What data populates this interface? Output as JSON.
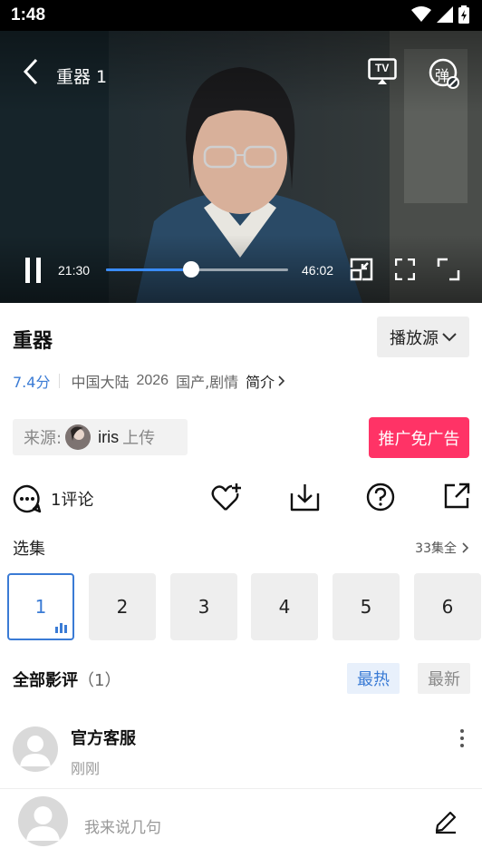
{
  "status": {
    "time": "1:48"
  },
  "player": {
    "title": "重器 1",
    "current_time": "21:30",
    "total_time": "46:02",
    "progress_fraction": 0.467,
    "tv_label": "TV",
    "danmaku_label": "弹"
  },
  "info": {
    "title": "重器",
    "source_button": "播放源",
    "score": "7.4分",
    "region": "中国大陆",
    "year": "2026",
    "genres": "国产,剧情",
    "intro_link": "简介"
  },
  "uploader": {
    "prefix": "来源:",
    "name": "iris",
    "suffix": "上传"
  },
  "promo_button": "推广免广告",
  "actions": {
    "comment_count": "1评论"
  },
  "episodes": {
    "label": "选集",
    "total": "33集全",
    "items": [
      "1",
      "2",
      "3",
      "4",
      "5",
      "6"
    ],
    "active_index": 0
  },
  "reviews": {
    "title": "全部影评",
    "count": "（1）",
    "tab_hot": "最热",
    "tab_new": "最新",
    "items": [
      {
        "author": "官方客服",
        "time": "刚刚"
      }
    ]
  },
  "input": {
    "placeholder": "我来说几句"
  },
  "colors": {
    "accent": "#3a7bd5",
    "promo": "#ff3366",
    "progress": "#3a8cff"
  }
}
